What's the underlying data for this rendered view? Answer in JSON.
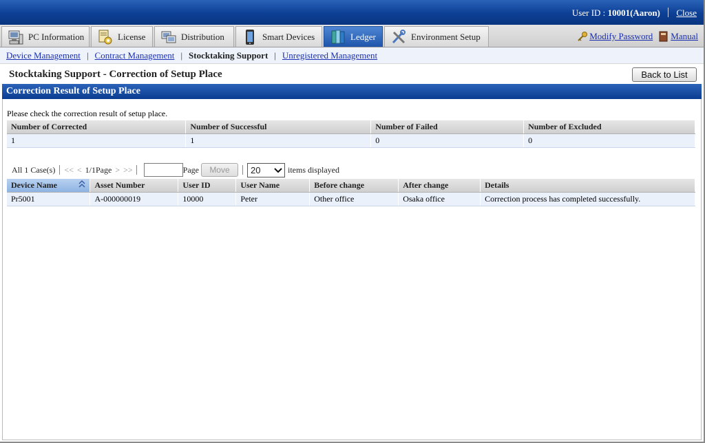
{
  "header": {
    "user_label": "User ID : ",
    "user_value": "10001(Aaron)",
    "close_label": "Close"
  },
  "tabs": [
    {
      "label": "PC Information",
      "icon": "pc-icon"
    },
    {
      "label": "License",
      "icon": "license-icon"
    },
    {
      "label": "Distribution",
      "icon": "distribution-icon"
    },
    {
      "label": "Smart Devices",
      "icon": "smartphone-icon"
    },
    {
      "label": "Ledger",
      "icon": "ledger-icon",
      "active": true
    },
    {
      "label": "Environment Setup",
      "icon": "tools-icon"
    }
  ],
  "right_links": {
    "modify_password": "Modify Password",
    "manual": "Manual"
  },
  "subnav": {
    "device_management": "Device Management",
    "contract_management": "Contract Management",
    "stocktaking_support": "Stocktaking Support",
    "unregistered_management": "Unregistered Management"
  },
  "page": {
    "title": "Stocktaking Support - Correction of Setup Place",
    "back_button": "Back to List",
    "section_title": "Correction Result of Setup Place",
    "note": "Please check the correction result of setup place."
  },
  "summary": {
    "headers": [
      "Number of Corrected",
      "Number of Successful",
      "Number of Failed",
      "Number of Excluded"
    ],
    "values": [
      "1",
      "1",
      "0",
      "0"
    ]
  },
  "pager": {
    "total": "All 1 Case(s)",
    "first": "<<",
    "prev": "<",
    "page_info": "1/1Page",
    "next": ">",
    "last": ">>",
    "page_input_value": "",
    "page_label": "Page",
    "move_button": "Move",
    "per_page": "20",
    "per_page_suffix": "items displayed"
  },
  "results": {
    "headers": [
      "Device Name",
      "Asset Number",
      "User ID",
      "User Name",
      "Before change",
      "After change",
      "Details"
    ],
    "rows": [
      [
        "Pr5001",
        "A-000000019",
        "10000",
        "Peter",
        "Other office",
        "Osaka office",
        "Correction process has completed successfully."
      ]
    ]
  },
  "colors": {
    "banner": "#0c3f95",
    "active_tab": "#1e55ab",
    "link": "#1a2fb0",
    "row_bg": "#eaf1fb"
  }
}
